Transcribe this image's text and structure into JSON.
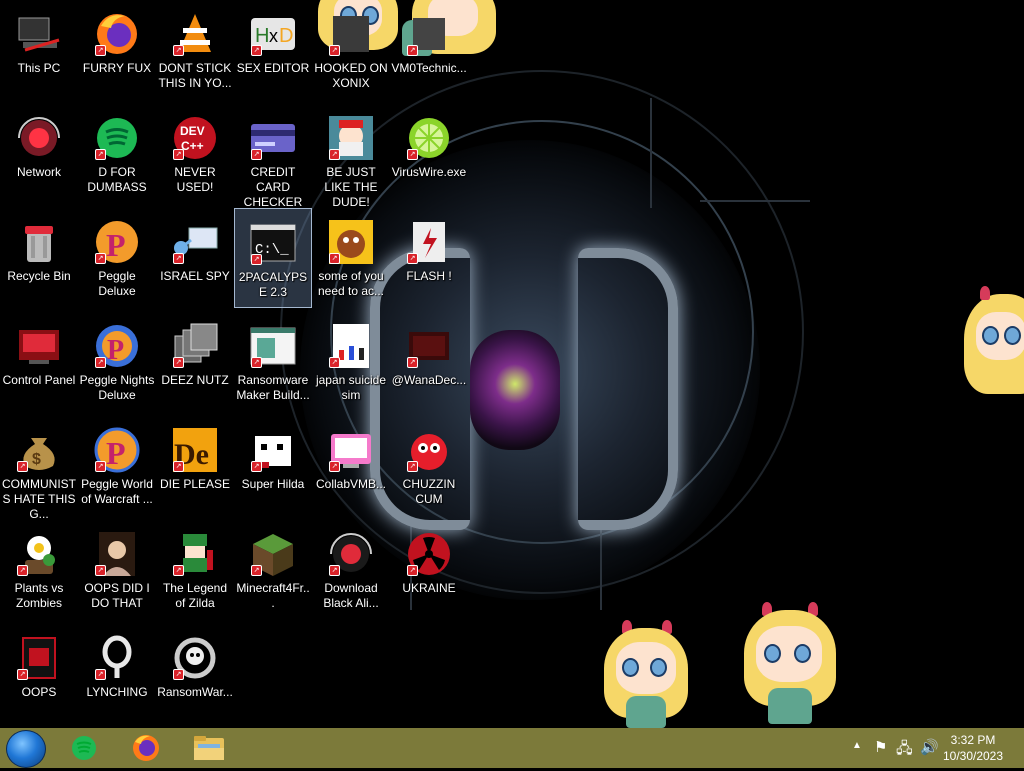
{
  "desktop": {
    "icons": [
      {
        "label": "This PC",
        "icon": "computer-icon"
      },
      {
        "label": "FURRY FUX",
        "icon": "firefox-icon"
      },
      {
        "label": "DONT STICK THIS IN YO...",
        "icon": "vlc-cone-icon"
      },
      {
        "label": "SEX EDITOR",
        "icon": "hxd-editor-icon"
      },
      {
        "label": "HOOKED ON XONIX",
        "icon": "game-icon"
      },
      {
        "label": "VM0Technic...",
        "icon": "app-icon"
      },
      {
        "label": "Network",
        "icon": "network-orb-icon"
      },
      {
        "label": "D FOR DUMBASS",
        "icon": "spotify-icon"
      },
      {
        "label": "NEVER USED!",
        "icon": "devcpp-icon"
      },
      {
        "label": "CREDIT CARD CHECKER",
        "icon": "credit-card-icon"
      },
      {
        "label": "BE JUST LIKE THE DUDE!",
        "icon": "dude-icon"
      },
      {
        "label": "VirusWire.exe",
        "icon": "lime-icon"
      },
      {
        "label": "Recycle Bin",
        "icon": "recycle-bin-icon"
      },
      {
        "label": "Peggle Deluxe",
        "icon": "peggle-icon"
      },
      {
        "label": "ISRAEL SPY",
        "icon": "spy-network-icon"
      },
      {
        "label": "2PACALYPSE 2.3",
        "icon": "console-icon"
      },
      {
        "label": "some of you need to ac...",
        "icon": "dog-icon"
      },
      {
        "label": "FLASH !",
        "icon": "flash-icon"
      },
      {
        "label": "Control Panel",
        "icon": "control-panel-icon"
      },
      {
        "label": "Peggle Nights Deluxe",
        "icon": "peggle-nights-icon"
      },
      {
        "label": "DEEZ NUTZ",
        "icon": "stacked-windows-icon"
      },
      {
        "label": "Ransomware Maker Build...",
        "icon": "window-app-icon"
      },
      {
        "label": "japan suicide sim",
        "icon": "document-icon"
      },
      {
        "label": "@WanaDec...",
        "icon": "wanadecrypt-icon"
      },
      {
        "label": "COMMUNISTS HATE THIS G...",
        "icon": "money-bag-icon"
      },
      {
        "label": "Peggle World of Warcraft ...",
        "icon": "peggle-wow-icon"
      },
      {
        "label": "DIE PLEASE",
        "icon": "de-icon"
      },
      {
        "label": "Super Hilda",
        "icon": "pixel-dog-icon"
      },
      {
        "label": "CollabVMB...",
        "icon": "collabvm-icon"
      },
      {
        "label": "CHUZZIN CUM",
        "icon": "chuzzle-icon"
      },
      {
        "label": "Plants vs Zombies",
        "icon": "pvz-icon"
      },
      {
        "label": "OOPS DID I DO THAT",
        "icon": "portrait-icon"
      },
      {
        "label": "The Legend of Zilda",
        "icon": "zelda-icon"
      },
      {
        "label": "Minecraft4Fr...",
        "icon": "minecraft-block-icon"
      },
      {
        "label": "Download Black Ali...",
        "icon": "black-orb-icon"
      },
      {
        "label": "UKRAINE",
        "icon": "radiation-icon"
      },
      {
        "label": "OOPS",
        "icon": "red-app-icon"
      },
      {
        "label": "LYNCHING",
        "icon": "rope-icon"
      },
      {
        "label": "RansomWar...",
        "icon": "skull-ring-icon"
      }
    ],
    "wallpaper_watermark": ""
  },
  "taskbar": {
    "start_icon": "start-orb-icon",
    "pinned": [
      {
        "name": "spotify",
        "icon": "spotify-icon"
      },
      {
        "name": "firefox",
        "icon": "firefox-icon"
      },
      {
        "name": "file explorer",
        "icon": "folder-icon"
      }
    ],
    "tray": {
      "icons": [
        "chevron-up-icon",
        "flag-icon",
        "network-icon",
        "speaker-icon"
      ]
    },
    "clock": {
      "time": "3:32 PM",
      "date": "10/30/2023"
    }
  },
  "colors": {
    "taskbar": "#7c7a3a",
    "desktop": "#000000",
    "selection": "#a5b8d0"
  }
}
